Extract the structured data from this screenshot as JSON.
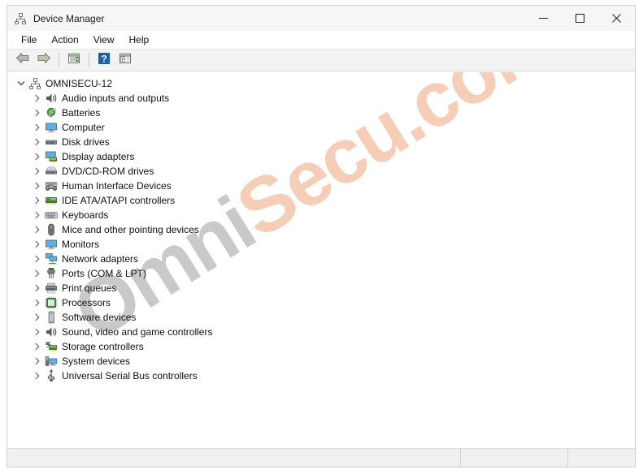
{
  "window": {
    "title": "Device Manager",
    "title_icon": "device-manager-icon",
    "caption": {
      "minimize_label": "─",
      "maximize_label": "□",
      "close_label": "✕",
      "minimize_name": "minimize-button",
      "maximize_name": "maximize-button",
      "close_name": "close-button"
    }
  },
  "menubar": {
    "items": [
      {
        "label": "File",
        "name": "menu-item-file"
      },
      {
        "label": "Action",
        "name": "menu-item-action"
      },
      {
        "label": "View",
        "name": "menu-item-view"
      },
      {
        "label": "Help",
        "name": "menu-item-help"
      }
    ]
  },
  "toolbar": {
    "items": [
      {
        "label": "Back",
        "icon": "back-arrow-icon"
      },
      {
        "label": "Forward",
        "icon": "forward-arrow-icon"
      },
      {
        "label": "Properties",
        "icon": "properties-icon"
      },
      {
        "label": "Help",
        "icon": "help-question-icon"
      },
      {
        "label": "Scan for hardware changes",
        "icon": "scan-hardware-icon"
      }
    ]
  },
  "tree": {
    "root": {
      "label": "OMNISECU-12",
      "icon": "computer-node-icon",
      "expanded": true,
      "twisty": "chevron-down-icon"
    },
    "children": [
      {
        "label": "Audio inputs and outputs",
        "icon": "speaker-icon"
      },
      {
        "label": "Batteries",
        "icon": "battery-icon"
      },
      {
        "label": "Computer",
        "icon": "monitor-icon"
      },
      {
        "label": "Disk drives",
        "icon": "disk-drive-icon"
      },
      {
        "label": "Display adapters",
        "icon": "display-adapter-icon"
      },
      {
        "label": "DVD/CD-ROM drives",
        "icon": "optical-drive-icon"
      },
      {
        "label": "Human Interface Devices",
        "icon": "hid-icon"
      },
      {
        "label": "IDE ATA/ATAPI controllers",
        "icon": "ide-controller-icon"
      },
      {
        "label": "Keyboards",
        "icon": "keyboard-icon"
      },
      {
        "label": "Mice and other pointing devices",
        "icon": "mouse-icon"
      },
      {
        "label": "Monitors",
        "icon": "monitor-icon"
      },
      {
        "label": "Network adapters",
        "icon": "network-adapter-icon"
      },
      {
        "label": "Ports (COM & LPT)",
        "icon": "port-connector-icon"
      },
      {
        "label": "Print queues",
        "icon": "printer-icon"
      },
      {
        "label": "Processors",
        "icon": "processor-icon"
      },
      {
        "label": "Software devices",
        "icon": "software-device-icon"
      },
      {
        "label": "Sound, video and game controllers",
        "icon": "speaker-icon"
      },
      {
        "label": "Storage controllers",
        "icon": "storage-controller-icon"
      },
      {
        "label": "System devices",
        "icon": "system-device-icon"
      },
      {
        "label": "Universal Serial Bus controllers",
        "icon": "usb-icon"
      }
    ],
    "child_twisty": "chevron-right-icon"
  },
  "statusbar": {
    "panes": [
      {
        "text": "",
        "name": "status-pane-main"
      },
      {
        "text": "",
        "name": "status-pane-middle"
      },
      {
        "text": "",
        "name": "status-pane-end"
      }
    ]
  },
  "watermark": {
    "part1": "Omni",
    "part2": "Secu.com",
    "color1": "#c9c9c9",
    "color2": "#f6cdb6"
  }
}
